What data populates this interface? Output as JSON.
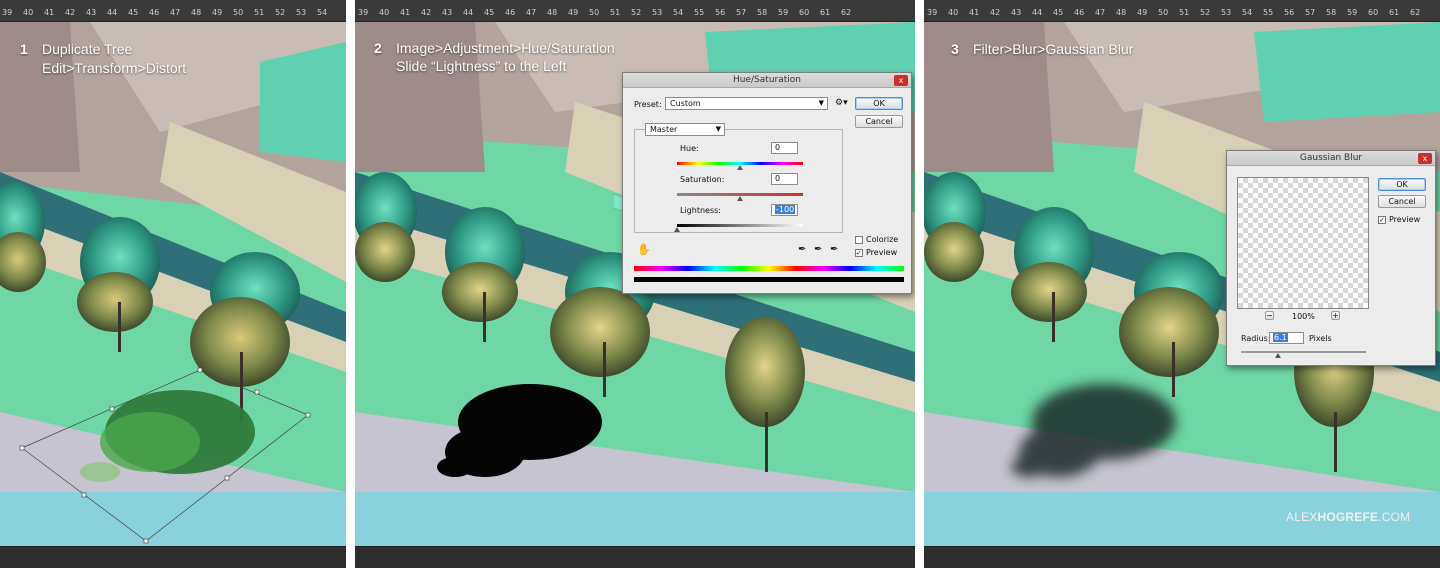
{
  "ruler_labels": [
    "39",
    "40",
    "41",
    "42",
    "43",
    "44",
    "45",
    "46",
    "47",
    "48",
    "49",
    "50",
    "51",
    "52",
    "53",
    "54",
    "55",
    "56",
    "57",
    "58",
    "59",
    "60",
    "61",
    "62"
  ],
  "panel1": {
    "step_number": "1",
    "line1": "Duplicate Tree",
    "line2": "Edit>Transform>Distort"
  },
  "panel2": {
    "step_number": "2",
    "line1": "Image>Adjustment>Hue/Saturation",
    "line2": "Slide “Lightness” to the Left",
    "dialog": {
      "title": "Hue/Saturation",
      "close": "x",
      "preset_label": "Preset:",
      "preset_value": "Custom",
      "ok": "OK",
      "cancel": "Cancel",
      "channel": "Master",
      "hue_label": "Hue:",
      "hue_value": "0",
      "saturation_label": "Saturation:",
      "saturation_value": "0",
      "lightness_label": "Lightness:",
      "lightness_value": "-100",
      "colorize_label": "Colorize",
      "colorize_checked": false,
      "preview_label": "Preview",
      "preview_checked": true
    }
  },
  "panel3": {
    "step_number": "3",
    "line1": "Filter>Blur>Gaussian Blur",
    "dialog": {
      "title": "Gaussian Blur",
      "close": "x",
      "ok": "OK",
      "cancel": "Cancel",
      "preview_label": "Preview",
      "preview_checked": true,
      "zoom_out": "−",
      "zoom_in": "+",
      "zoom_value": "100%",
      "radius_label": "Radius:",
      "radius_value": "6.1",
      "radius_unit": "Pixels"
    },
    "watermark_light": "ALEX",
    "watermark_bold": "HOGREFE",
    "watermark_tail": ".COM"
  },
  "colors": {
    "ground": "#6fd6a5",
    "water": "#7fd4e0",
    "wall": "#b3a39d",
    "ledge": "#d9d1b6",
    "accent_arrow": "#7fe8c8"
  }
}
